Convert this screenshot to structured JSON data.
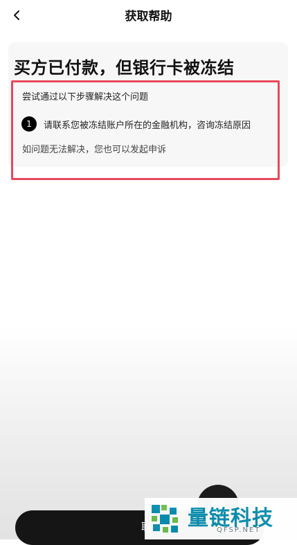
{
  "header": {
    "title": "获取帮助"
  },
  "card": {
    "title": "买方已付款，但银行卡被冻结",
    "intro": "尝试通过以下步骤解决这个问题",
    "steps": [
      {
        "number": "1",
        "text": "请联系您被冻结账户所在的金融机构，咨询冻结原因"
      }
    ],
    "appeal": "如问题无法解决，您也可以发起申诉"
  },
  "footer": {
    "contact_label": "联系"
  },
  "watermark": {
    "name": "量链科技",
    "domain": "QFSP.NET"
  },
  "colors": {
    "highlight_border": "#e8485a",
    "button_bg": "#151515",
    "watermark": "#0b8fb0"
  }
}
